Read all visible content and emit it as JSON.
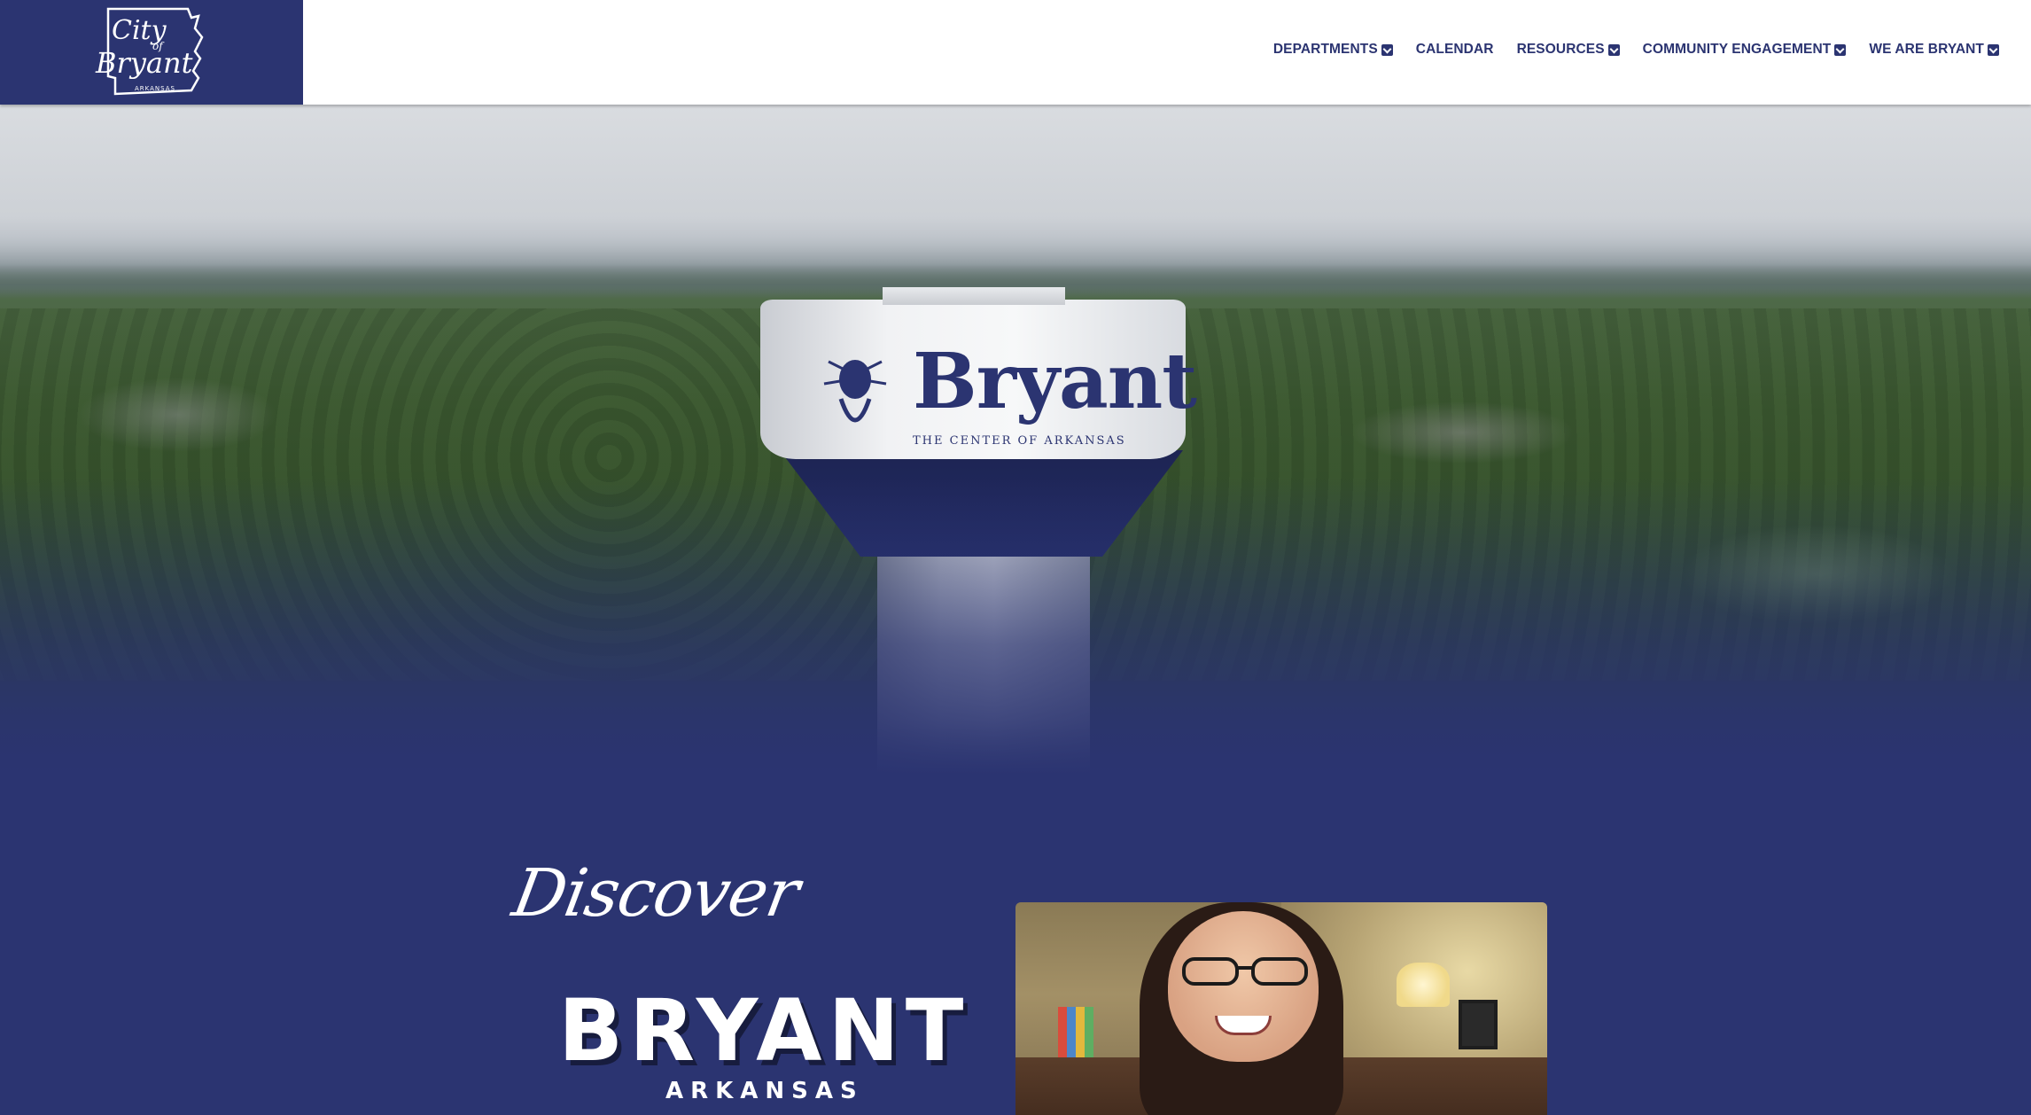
{
  "header": {
    "logo_alt": "City of Bryant Arkansas",
    "logo_lines": [
      "City",
      "of",
      "Bryant",
      "ARKANSAS"
    ],
    "nav": [
      {
        "label": "DEPARTMENTS",
        "has_dropdown": true
      },
      {
        "label": "CALENDAR",
        "has_dropdown": false
      },
      {
        "label": "RESOURCES",
        "has_dropdown": true
      },
      {
        "label": "COMMUNITY ENGAGEMENT",
        "has_dropdown": true
      },
      {
        "label": "WE ARE BRYANT",
        "has_dropdown": true
      }
    ]
  },
  "hero": {
    "tower_text": "Bryant",
    "tower_subtext": "THE CENTER OF ARKANSAS"
  },
  "discover": {
    "script_heading": "Discover",
    "title": "BRYANT",
    "subtitle": "ARKANSAS"
  },
  "colors": {
    "brand_navy": "#2b3471",
    "header_bg": "#ffffff",
    "text_light": "#ffffff"
  },
  "icons": {
    "dropdown": "chevron-down-icon",
    "logo": "arkansas-state-outline-icon"
  }
}
